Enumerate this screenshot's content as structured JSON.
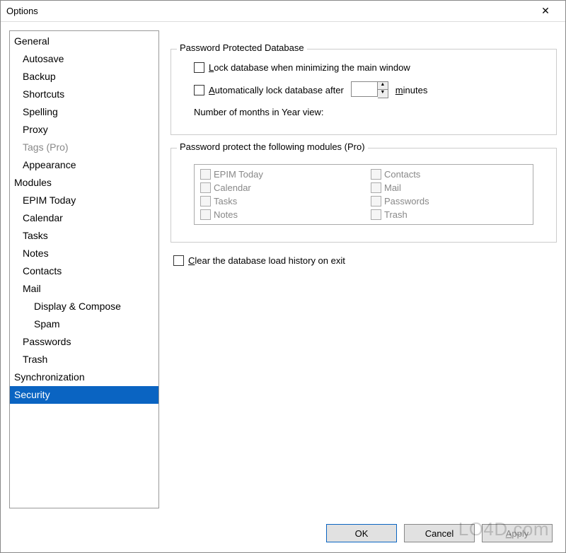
{
  "window": {
    "title": "Options"
  },
  "sidebar": {
    "items": [
      {
        "label": "General",
        "indent": 0
      },
      {
        "label": "Autosave",
        "indent": 1
      },
      {
        "label": "Backup",
        "indent": 1
      },
      {
        "label": "Shortcuts",
        "indent": 1
      },
      {
        "label": "Spelling",
        "indent": 1
      },
      {
        "label": "Proxy",
        "indent": 1
      },
      {
        "label": "Tags (Pro)",
        "indent": 1,
        "disabled": true
      },
      {
        "label": "Appearance",
        "indent": 1
      },
      {
        "label": "Modules",
        "indent": 0
      },
      {
        "label": "EPIM Today",
        "indent": 1
      },
      {
        "label": "Calendar",
        "indent": 1
      },
      {
        "label": "Tasks",
        "indent": 1
      },
      {
        "label": "Notes",
        "indent": 1
      },
      {
        "label": "Contacts",
        "indent": 1
      },
      {
        "label": "Mail",
        "indent": 1
      },
      {
        "label": "Display & Compose",
        "indent": 2
      },
      {
        "label": "Spam",
        "indent": 2
      },
      {
        "label": "Passwords",
        "indent": 1
      },
      {
        "label": "Trash",
        "indent": 1
      },
      {
        "label": "Synchronization",
        "indent": 0
      },
      {
        "label": "Security",
        "indent": 0,
        "selected": true
      }
    ]
  },
  "group1": {
    "title": "Password Protected Database",
    "lock_prefix": "L",
    "lock_rest": "ock database when minimizing the main window",
    "autolock_prefix": "A",
    "autolock_rest": "utomatically lock database after",
    "autolock_value": "",
    "minutes_prefix": "m",
    "minutes_rest": "inutes",
    "months_label": "Number of months in Year view:"
  },
  "group2": {
    "title": "Password protect the following modules (Pro)",
    "left": [
      "EPIM Today",
      "Calendar",
      "Tasks",
      "Notes"
    ],
    "right": [
      "Contacts",
      "Mail",
      "Passwords",
      "Trash"
    ]
  },
  "clear": {
    "prefix": "C",
    "rest": "lear the database load history on exit"
  },
  "buttons": {
    "ok": "OK",
    "cancel": "Cancel",
    "apply_prefix": "A",
    "apply_rest": "pply"
  },
  "watermark": "LO4D.com"
}
